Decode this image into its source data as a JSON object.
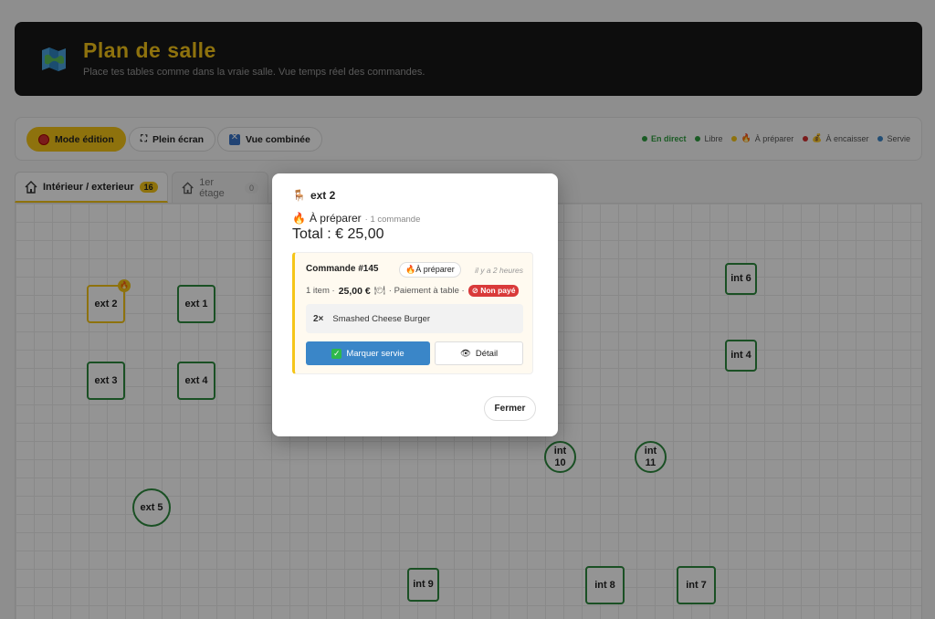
{
  "header": {
    "title": "Plan de salle",
    "subtitle": "Place tes tables comme dans la vraie salle. Vue temps réel des commandes."
  },
  "toolbar": {
    "edit_mode": "Mode édition",
    "fullscreen": "Plein écran",
    "combined": "Vue combinée"
  },
  "legend": {
    "live": "En direct",
    "free": "Libre",
    "to_prepare": "À préparer",
    "to_collect": "À encaisser",
    "served": "Servie",
    "colors": {
      "live": "#2e9e3e",
      "free": "#2e9e3e",
      "to_prepare": "#f5c518",
      "to_collect": "#d32f2f",
      "served": "#3a86c8"
    }
  },
  "tabs": [
    {
      "label": "Intérieur / exterieur",
      "count": "16"
    },
    {
      "label": "1er étage",
      "count": "0"
    }
  ],
  "tables": [
    {
      "label": "ext 2",
      "status": "to_prepare"
    },
    {
      "label": "ext 1"
    },
    {
      "label": "ext 3"
    },
    {
      "label": "ext 4"
    },
    {
      "label": "ext 5"
    },
    {
      "label": "int 6"
    },
    {
      "label": "int 4"
    },
    {
      "label": "int 10"
    },
    {
      "label": "int 11"
    },
    {
      "label": "int 9"
    },
    {
      "label": "int 8"
    },
    {
      "label": "int 7"
    }
  ],
  "modal": {
    "table_name": "ext 2",
    "status": "À préparer",
    "order_count": "· 1 commande",
    "total": "Total : € 25,00",
    "order": {
      "number": "Commande #145",
      "status_chip": "À préparer",
      "time": "il y a 2 heures",
      "items": "1 item ·",
      "price": "25,00 €",
      "payment": "· Paiement à table ·",
      "unpaid": "Non payé",
      "line_qty": "2×",
      "line_name": "Smashed Cheese Burger",
      "serve_button": "Marquer servie",
      "detail_button": "Détail"
    },
    "close_button": "Fermer"
  }
}
